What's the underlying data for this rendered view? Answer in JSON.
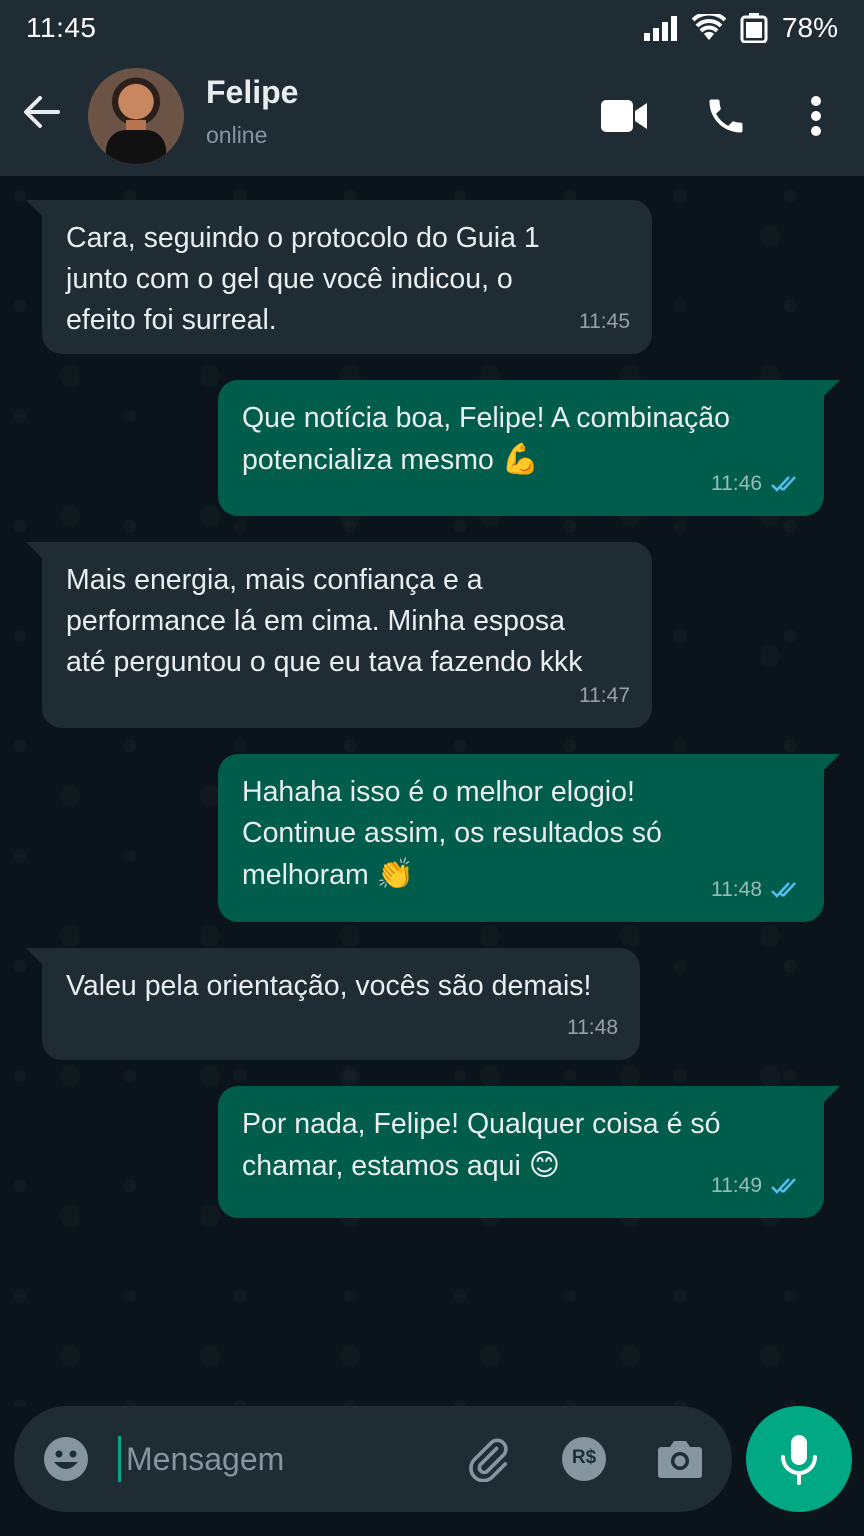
{
  "status_bar": {
    "time": "11:45",
    "battery": "78%"
  },
  "header": {
    "name": "Felipe",
    "status": "online"
  },
  "messages": [
    {
      "direction": "in",
      "text": "Cara, seguindo o protocolo do Guia 1\njunto com o gel que você indicou, o\nefeito foi surreal.",
      "time": "11:45"
    },
    {
      "direction": "out",
      "text": "Que notícia boa, Felipe! A combinação\npotencializa mesmo",
      "emoji": "💪",
      "time": "11:46"
    },
    {
      "direction": "in",
      "text": "Mais energia, mais confiança e a\nperformance lá em cima. Minha esposa\naté perguntou o que eu tava fazendo kkk",
      "time": "11:47"
    },
    {
      "direction": "out",
      "text": "Hahaha isso é o melhor elogio!\nContinue assim, os resultados só\nmelhoram",
      "emoji": "👏",
      "time": "11:48"
    },
    {
      "direction": "in",
      "text": "Valeu pela orientação, vocês são demais!",
      "time": "11:48"
    },
    {
      "direction": "out",
      "text": "Por nada, Felipe! Qualquer coisa é só\nchamar, estamos aqui",
      "emoji": "😊",
      "time": "11:49"
    }
  ],
  "input": {
    "placeholder": "Mensagem",
    "currency_label": "R$"
  },
  "icons": {
    "back": "arrow-left-icon",
    "video": "video-call-icon",
    "call": "phone-icon",
    "menu": "more-vert-icon",
    "emoji": "emoji-icon",
    "attach": "paperclip-icon",
    "payment": "payment-icon",
    "camera": "camera-icon",
    "mic": "mic-icon",
    "read": "double-check-icon"
  },
  "colors": {
    "header": "#1f2c34",
    "background": "#0b141a",
    "incoming": "#202c33",
    "outgoing": "#005c4b",
    "accent": "#00a884",
    "read_ticks": "#53bdeb"
  }
}
